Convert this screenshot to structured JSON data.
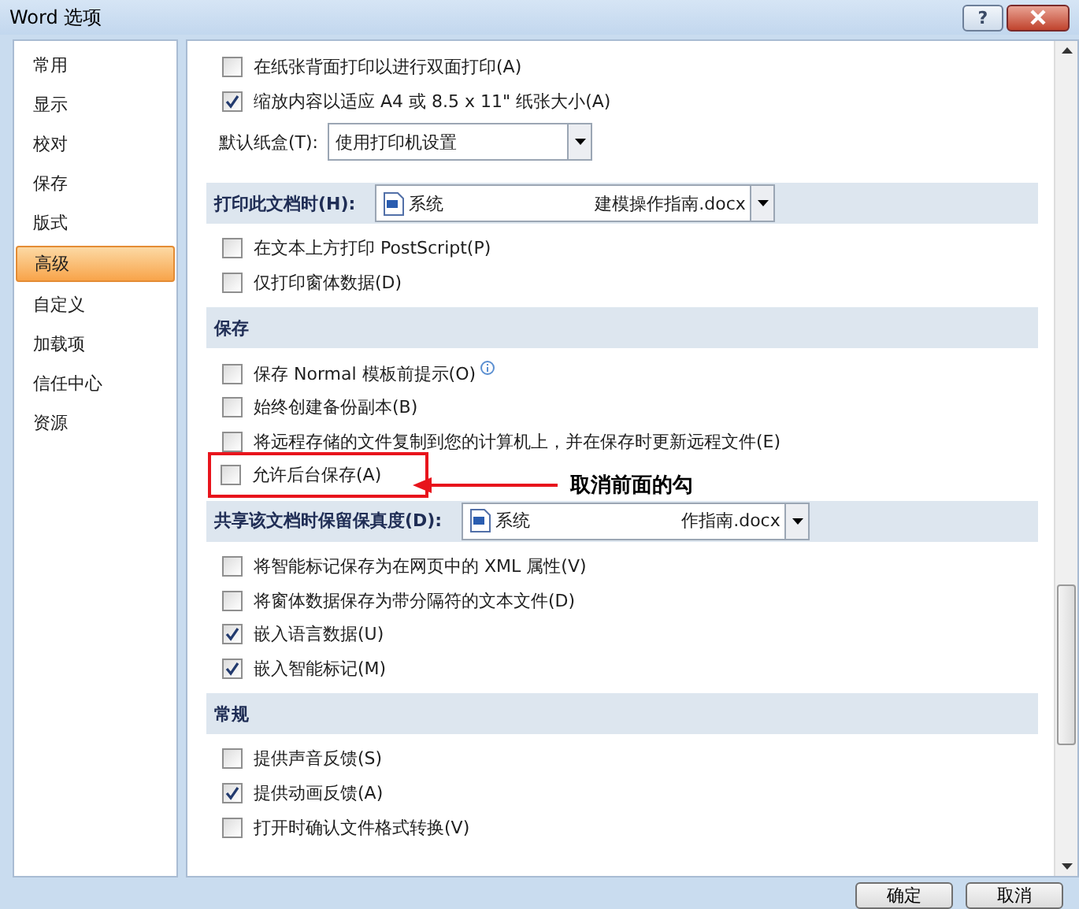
{
  "window": {
    "title": "Word 选项",
    "help": "?"
  },
  "sidebar": {
    "items": [
      {
        "label": "常用",
        "selected": false
      },
      {
        "label": "显示",
        "selected": false
      },
      {
        "label": "校对",
        "selected": false
      },
      {
        "label": "保存",
        "selected": false
      },
      {
        "label": "版式",
        "selected": false
      },
      {
        "label": "高级",
        "selected": true
      },
      {
        "label": "自定义",
        "selected": false
      },
      {
        "label": "加载项",
        "selected": false
      },
      {
        "label": "信任中心",
        "selected": false
      },
      {
        "label": "资源",
        "selected": false
      }
    ]
  },
  "options": [
    {
      "kind": "checkbox",
      "label": "在纸张背面打印以进行双面打印(A)",
      "checked": false,
      "highlighted": false
    },
    {
      "kind": "checkbox",
      "label": "缩放内容以适应 A4 或 8.5 x 11\" 纸张大小(A)",
      "checked": true,
      "highlighted": false
    },
    {
      "kind": "select",
      "label": "默认纸盒(T):",
      "value": "使用打印机设置"
    },
    {
      "kind": "header",
      "label": "打印此文档时(H):",
      "file_start": "系统",
      "file_end": "建模操作指南.docx"
    },
    {
      "kind": "checkbox",
      "label": "在文本上方打印 PostScript(P)",
      "checked": false,
      "highlighted": false
    },
    {
      "kind": "checkbox",
      "label": "仅打印窗体数据(D)",
      "checked": false,
      "highlighted": false
    },
    {
      "kind": "header",
      "label": "保存"
    },
    {
      "kind": "checkbox",
      "label": "保存 Normal 模板前提示(O)",
      "checked": false,
      "highlighted": false,
      "info": true
    },
    {
      "kind": "checkbox",
      "label": "始终创建备份副本(B)",
      "checked": false,
      "highlighted": false
    },
    {
      "kind": "checkbox",
      "label": "将远程存储的文件复制到您的计算机上，并在保存时更新远程文件(E)",
      "checked": false,
      "highlighted": false
    },
    {
      "kind": "checkbox",
      "label": "允许后台保存(A)",
      "checked": false,
      "highlighted": true
    },
    {
      "kind": "header",
      "label": "共享该文档时保留保真度(D):",
      "file_start": "系统",
      "file_end": "作指南.docx"
    },
    {
      "kind": "checkbox",
      "label": "将智能标记保存为在网页中的 XML 属性(V)",
      "checked": false,
      "highlighted": false
    },
    {
      "kind": "checkbox",
      "label": "将窗体数据保存为带分隔符的文本文件(D)",
      "checked": false,
      "highlighted": false
    },
    {
      "kind": "checkbox",
      "label": "嵌入语言数据(U)",
      "checked": true,
      "highlighted": false
    },
    {
      "kind": "checkbox",
      "label": "嵌入智能标记(M)",
      "checked": true,
      "highlighted": false
    },
    {
      "kind": "header",
      "label": "常规"
    },
    {
      "kind": "checkbox",
      "label": "提供声音反馈(S)",
      "checked": false,
      "highlighted": false
    },
    {
      "kind": "checkbox",
      "label": "提供动画反馈(A)",
      "checked": true,
      "highlighted": false
    },
    {
      "kind": "checkbox",
      "label": "打开时确认文件格式转换(V)",
      "checked": false,
      "highlighted": false
    }
  ],
  "annotation": {
    "text": "取消前面的勾"
  },
  "buttons": [
    "确定",
    "取消"
  ]
}
